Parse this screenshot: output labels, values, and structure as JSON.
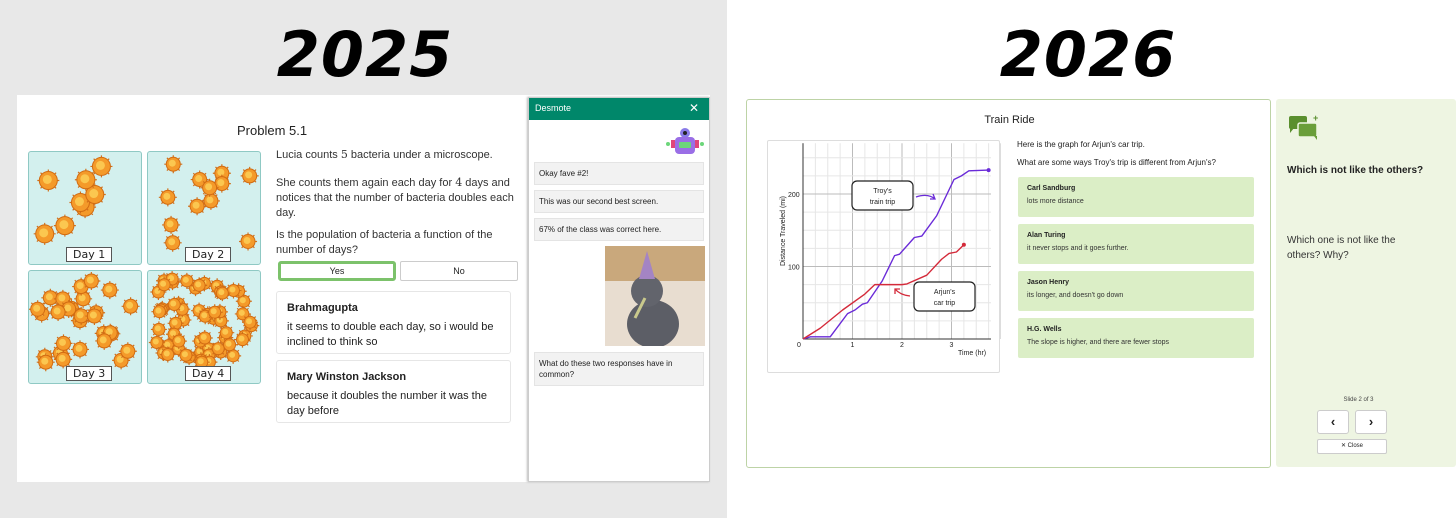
{
  "left": {
    "year": "2025",
    "problem_title": "Problem 5.1",
    "tiles": [
      {
        "label": "Day 1",
        "count": 8
      },
      {
        "label": "Day 2",
        "count": 12
      },
      {
        "label": "Day 3",
        "count": 28
      },
      {
        "label": "Day 4",
        "count": 60
      }
    ],
    "prompt": {
      "p1a": "Lucia counts",
      "n1": "5",
      "p1b": "bacteria under a microscope.",
      "p2a": "She counts them again each day for",
      "n2": "4",
      "p2b": "days and notices that the number of bacteria doubles each day.",
      "q": "Is the population of bacteria a function of the number of days?"
    },
    "options": [
      {
        "label": "Yes",
        "selected": true
      },
      {
        "label": "No",
        "selected": false
      }
    ],
    "responses": [
      {
        "name": "Brahmagupta",
        "text": "it seems to double each day, so i would be inclined to think so"
      },
      {
        "name": "Mary Winston Jackson",
        "text": "because it doubles the number it was the day before"
      }
    ],
    "desmote": {
      "title": "Desmote",
      "close": "✕",
      "messages": [
        "Okay fave #2!",
        "This was our second best screen.",
        "67% of the class was correct here."
      ],
      "final_message": "What do these two responses have in common?"
    }
  },
  "right": {
    "year": "2026",
    "title": "Train Ride",
    "intro": "Here is the graph for Arjun's car trip.",
    "question": "What are some ways Troy's trip is different from Arjun's?",
    "cards": [
      {
        "name": "Carl Sandburg",
        "text": "lots more distance"
      },
      {
        "name": "Alan Turing",
        "text": "it never stops and it goes further."
      },
      {
        "name": "Jason Henry",
        "text": "its longer, and doesn't go down"
      },
      {
        "name": "H.G. Wells",
        "text": "The slope is higher, and there are fewer stops"
      }
    ],
    "side": {
      "heading": "Which is not like the others?",
      "body": "Which one is not like the others? Why?",
      "slide": "Slide 2 of 3",
      "prev": "‹",
      "next": "›",
      "close": "✕  Close"
    }
  },
  "chart_data": {
    "type": "line",
    "xlabel": "Time (hr)",
    "ylabel": "Distance Traveled (mi)",
    "xlim": [
      0,
      4
    ],
    "ylim": [
      0,
      270
    ],
    "xticks": [
      "0",
      "1",
      "2",
      "3"
    ],
    "yticks": [
      "100",
      "200"
    ],
    "grid": true,
    "series": [
      {
        "name": "Troy's train trip",
        "label1": "Troy's",
        "label2": "train trip",
        "color": "#6a2bd8",
        "points": [
          [
            0,
            0
          ],
          [
            0.15,
            3
          ],
          [
            0.55,
            3
          ],
          [
            0.9,
            35
          ],
          [
            1.05,
            40
          ],
          [
            1.2,
            48
          ],
          [
            1.3,
            50
          ],
          [
            1.6,
            80
          ],
          [
            1.85,
            115
          ],
          [
            1.95,
            117
          ],
          [
            2.25,
            140
          ],
          [
            2.4,
            142
          ],
          [
            2.7,
            170
          ],
          [
            3.05,
            220
          ],
          [
            3.2,
            225
          ],
          [
            3.35,
            232
          ],
          [
            3.75,
            233
          ]
        ]
      },
      {
        "name": "Arjun's car trip",
        "label1": "Arjun's",
        "label2": "car trip",
        "color": "#d42a3a",
        "points": [
          [
            0,
            0
          ],
          [
            0.35,
            15
          ],
          [
            0.8,
            40
          ],
          [
            1.25,
            62
          ],
          [
            1.45,
            75
          ],
          [
            2.0,
            75
          ],
          [
            2.1,
            76
          ],
          [
            2.5,
            88
          ],
          [
            2.8,
            110
          ],
          [
            2.95,
            118
          ],
          [
            3.1,
            120
          ],
          [
            3.25,
            130
          ]
        ]
      }
    ]
  }
}
